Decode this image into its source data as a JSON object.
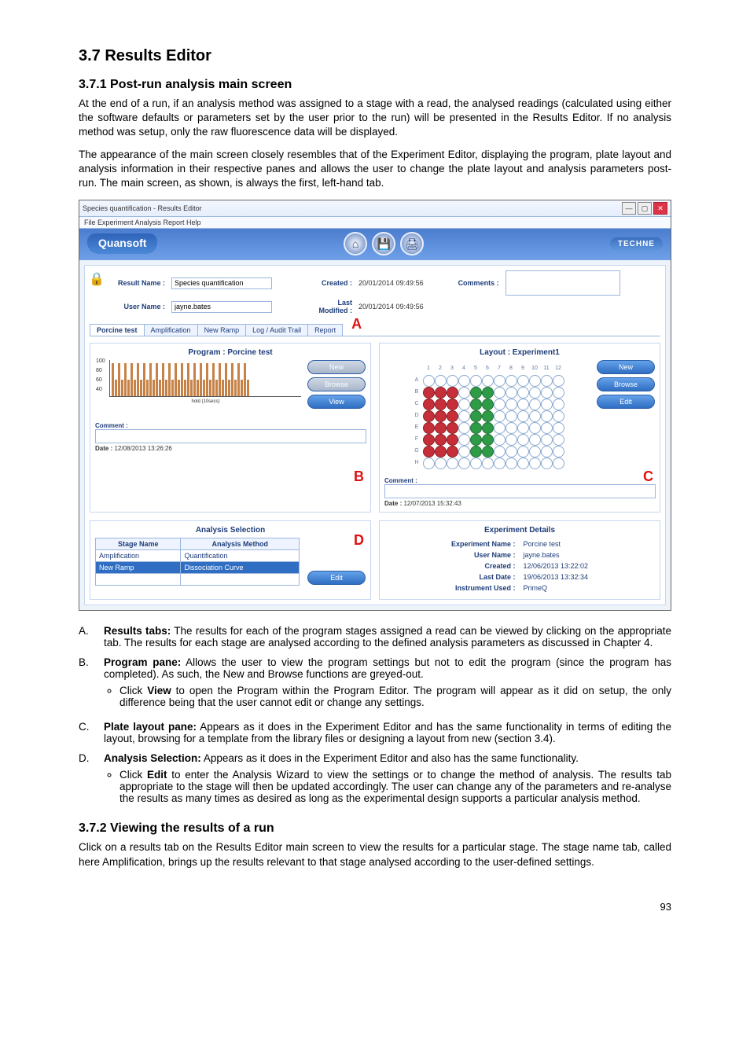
{
  "headings": {
    "h37": "3.7  Results Editor",
    "h371": "3.7.1  Post-run analysis main screen",
    "h372": "3.7.2  Viewing the results of a run"
  },
  "paras": {
    "p1": "At the end of a run, if an analysis method was assigned to a stage with a read, the analysed readings (calculated using either the software defaults or parameters set by the user prior to the run) will be presented in the Results Editor. If no analysis method was setup, only the raw fluorescence data will be displayed.",
    "p2": "The appearance of the main screen closely resembles that of the Experiment Editor, displaying the program, plate layout and analysis information in their respective panes and allows the user to change the plate layout and analysis parameters post-run. The main screen, as shown, is always the first, left-hand tab.",
    "p3": "Click on a results tab on the Results Editor main screen to view the results for a particular stage. The stage name tab, called here Amplification, brings up the results relevant to that stage analysed according to the user-defined settings."
  },
  "listA": {
    "A": {
      "head": "Results tabs:",
      "body": "The results for each of the program stages assigned a read can be viewed by clicking on the appropriate tab. The results for each stage are analysed according to the defined analysis parameters as discussed in Chapter 4."
    },
    "B": {
      "head": "Program pane:",
      "body": "Allows the user to view the program settings but not to edit the program (since the program has completed). As such, the New and Browse functions are greyed-out.",
      "sub": "Click View to open the Program within the Program Editor. The program will appear as it did on setup, the only difference being that the user cannot edit or change any settings.",
      "sub_bold": "View"
    },
    "C": {
      "head": "Plate layout pane:",
      "body": "Appears as it does in the Experiment Editor and has the same functionality in terms of editing the layout, browsing for a template from the library files or designing a layout from new (section 3.4)."
    },
    "D": {
      "head": "Analysis Selection:",
      "body": "Appears as it does in the Experiment Editor and also has the same functionality.",
      "sub": "Click Edit to enter the Analysis Wizard to view the settings or to change the method of analysis. The results tab appropriate to the stage will then be updated accordingly. The user can change any of the parameters and re-analyse the results as many times as desired as long as the experimental design supports a particular analysis method.",
      "sub_bold": "Edit"
    }
  },
  "page_number": "93",
  "shot": {
    "win_title": "Species quantification - Results Editor",
    "menu": "File   Experiment   Analysis   Report   Help",
    "brand": "Quansoft",
    "brand2": "TECHNE",
    "rbtn_home": "⌂",
    "rbtn_save": "💾",
    "rbtn_print": "🖨",
    "result_name_lbl": "Result Name :",
    "result_name_val": "Species quantification",
    "user_name_lbl": "User Name :",
    "user_name_val": "jayne.bates",
    "created_lbl": "Created :",
    "created_val": "20/01/2014 09:49:56",
    "modified_lbl": "Last Modified :",
    "modified_val": "20/01/2014 09:49:56",
    "comments_lbl": "Comments :",
    "tabs": {
      "t1": "Porcine test",
      "t2": "Amplification",
      "t3": "New Ramp",
      "t4": "Log / Audit Trail",
      "t5": "Report"
    },
    "program": {
      "title": "Program :  Porcine test",
      "btn_new": "New",
      "btn_browse": "Browse",
      "btn_view": "View",
      "yticks": [
        "100",
        "80",
        "60",
        "40"
      ],
      "xlabel": "hold (10secs)",
      "comment_lbl": "Comment :",
      "date_lbl": "Date :",
      "date_val": "12/08/2013 13:26:26"
    },
    "layout": {
      "title": "Layout :  Experiment1",
      "btn_new": "New",
      "btn_browse": "Browse",
      "btn_edit": "Edit",
      "cols": [
        "1",
        "2",
        "3",
        "4",
        "5",
        "6",
        "7",
        "8",
        "9",
        "10",
        "11",
        "12"
      ],
      "rows": [
        "A",
        "B",
        "C",
        "D",
        "E",
        "F",
        "G",
        "H"
      ],
      "red": [
        "B1",
        "B2",
        "B3",
        "C1",
        "C2",
        "C3",
        "D1",
        "D2",
        "D3",
        "E1",
        "E2",
        "E3",
        "F1",
        "F2",
        "F3",
        "G1",
        "G2",
        "G3"
      ],
      "green": [
        "B5",
        "B6",
        "C5",
        "C6",
        "D5",
        "D6",
        "E5",
        "E6",
        "F5",
        "F6",
        "G5",
        "G6"
      ],
      "comment_lbl": "Comment :",
      "date_lbl": "Date :",
      "date_val": "12/07/2013 15:32:43"
    },
    "analysis": {
      "title": "Analysis Selection",
      "col1": "Stage Name",
      "col2": "Analysis Method",
      "r1c1": "Amplification",
      "r1c2": "Quantification",
      "r2c1": "New Ramp",
      "r2c2": "Dissociation Curve",
      "btn_edit": "Edit"
    },
    "expdetails": {
      "title": "Experiment Details",
      "k1": "Experiment Name :",
      "v1": "Porcine test",
      "k2": "User Name :",
      "v2": "jayne.bates",
      "k3": "Created :",
      "v3": "12/06/2013 13:22:02",
      "k4": "Last Date :",
      "v4": "19/06/2013 13:32:34",
      "k5": "Instrument Used :",
      "v5": "PrimeQ"
    },
    "letters": {
      "A": "A",
      "B": "B",
      "C": "C",
      "D": "D"
    }
  }
}
